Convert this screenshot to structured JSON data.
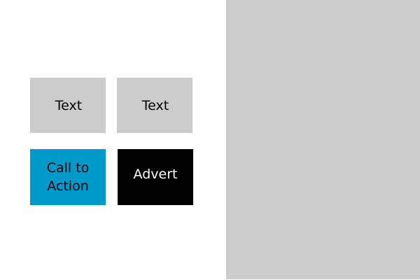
{
  "tiles": {
    "text_1": {
      "label": "Text"
    },
    "text_2": {
      "label": "Text"
    },
    "call_to_action": {
      "label": "Call to Action"
    },
    "advert": {
      "label": "Advert"
    }
  },
  "colors": {
    "page_background": "#ffffff",
    "panel_gray": "#cccccc",
    "cta_blue": "#0099cc",
    "advert_black": "#000000",
    "advert_text": "#ffffff"
  }
}
